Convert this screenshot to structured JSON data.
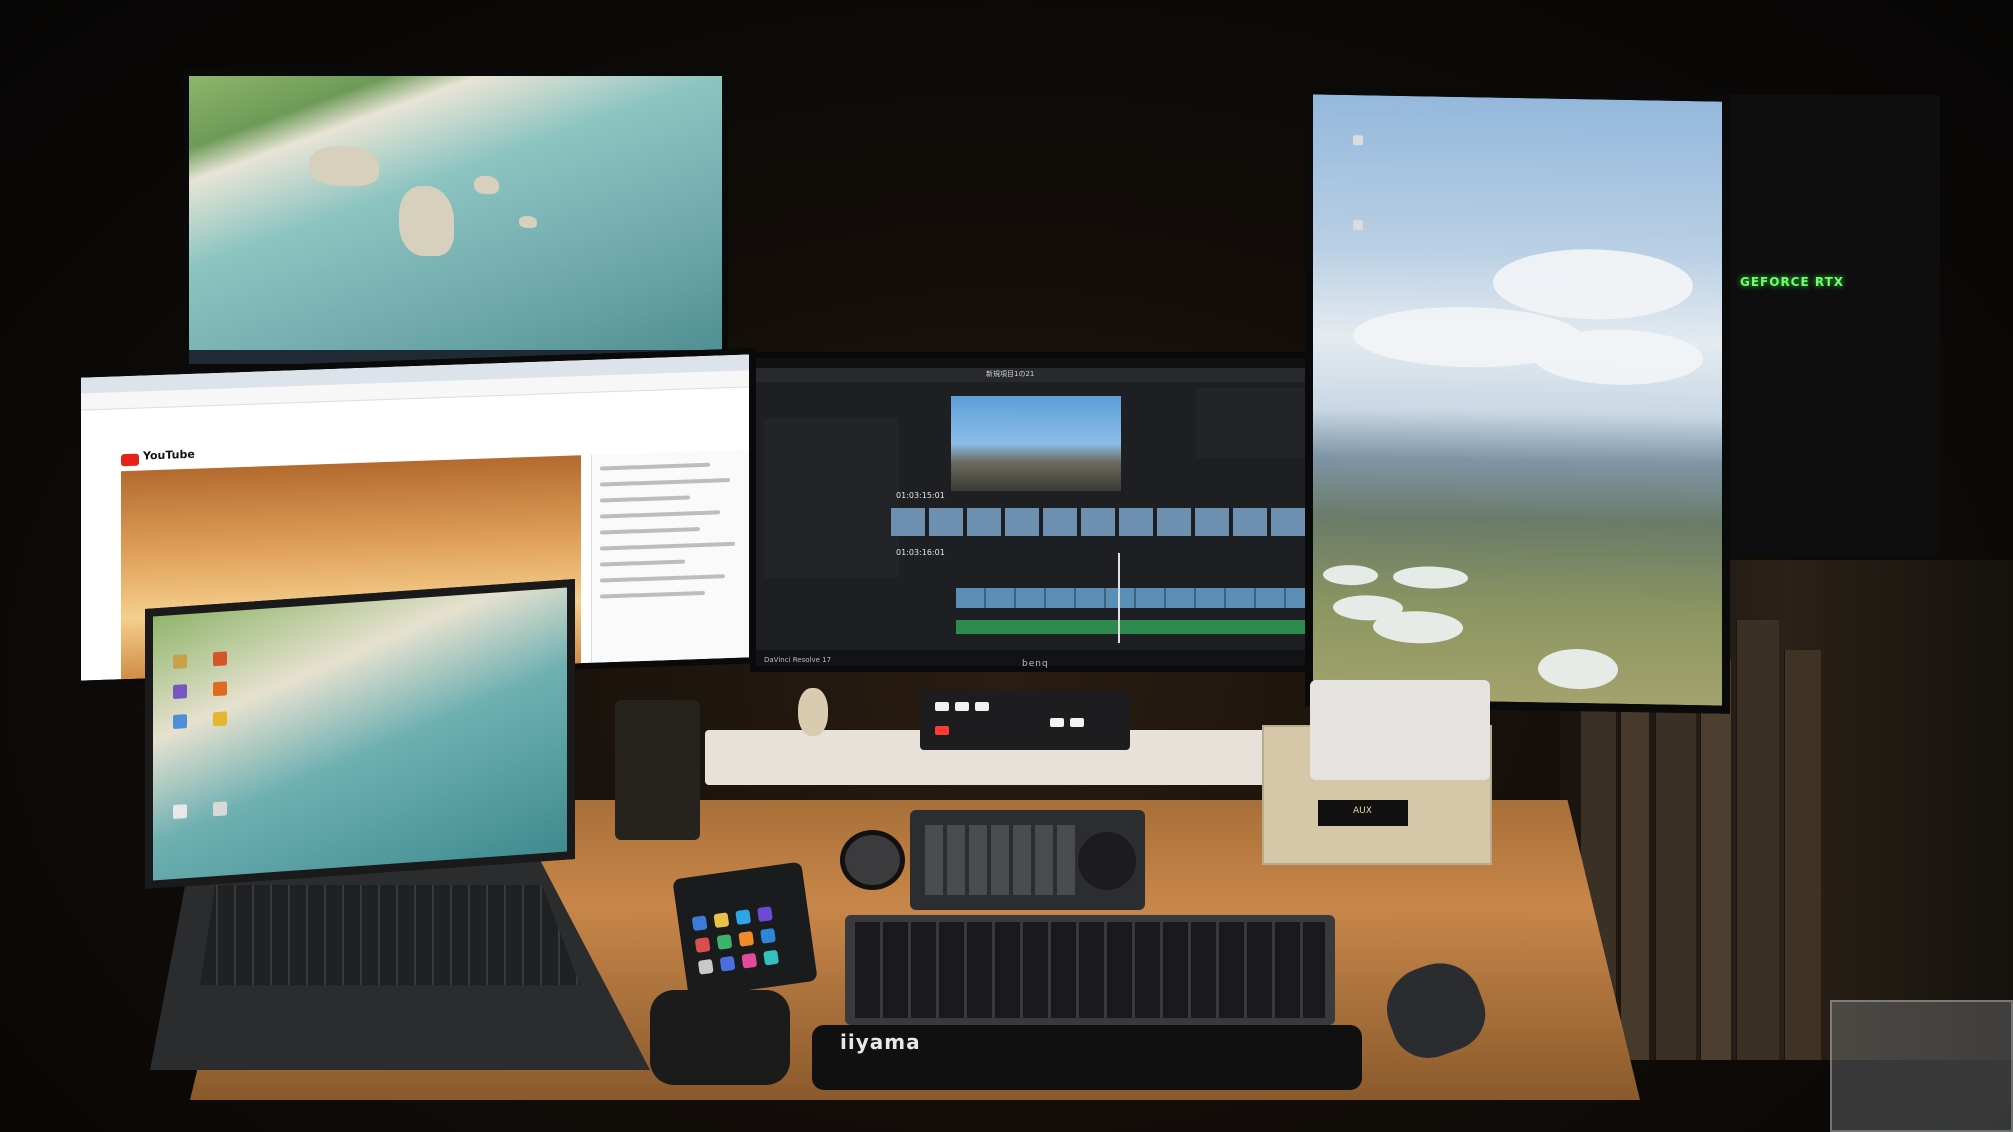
{
  "center_monitor": {
    "app_name": "DaVinci Resolve 17",
    "project_title": "新規項目1の21",
    "timecode_viewer": "01:03:15:01",
    "timecode_timeline": "01:03:16:01",
    "brand": "benq"
  },
  "browser_monitor": {
    "site_label": "YouTube"
  },
  "amp": {
    "display_text": "AUX"
  },
  "pc_case": {
    "label": "GEFORCE RTX"
  },
  "keyboard": {
    "palm_rest_brand": "iiyama"
  },
  "colors": {
    "rgb_green": "#6dff6d",
    "youtube_red": "#e62117",
    "resolve_audio_green": "#2e8a4e"
  }
}
